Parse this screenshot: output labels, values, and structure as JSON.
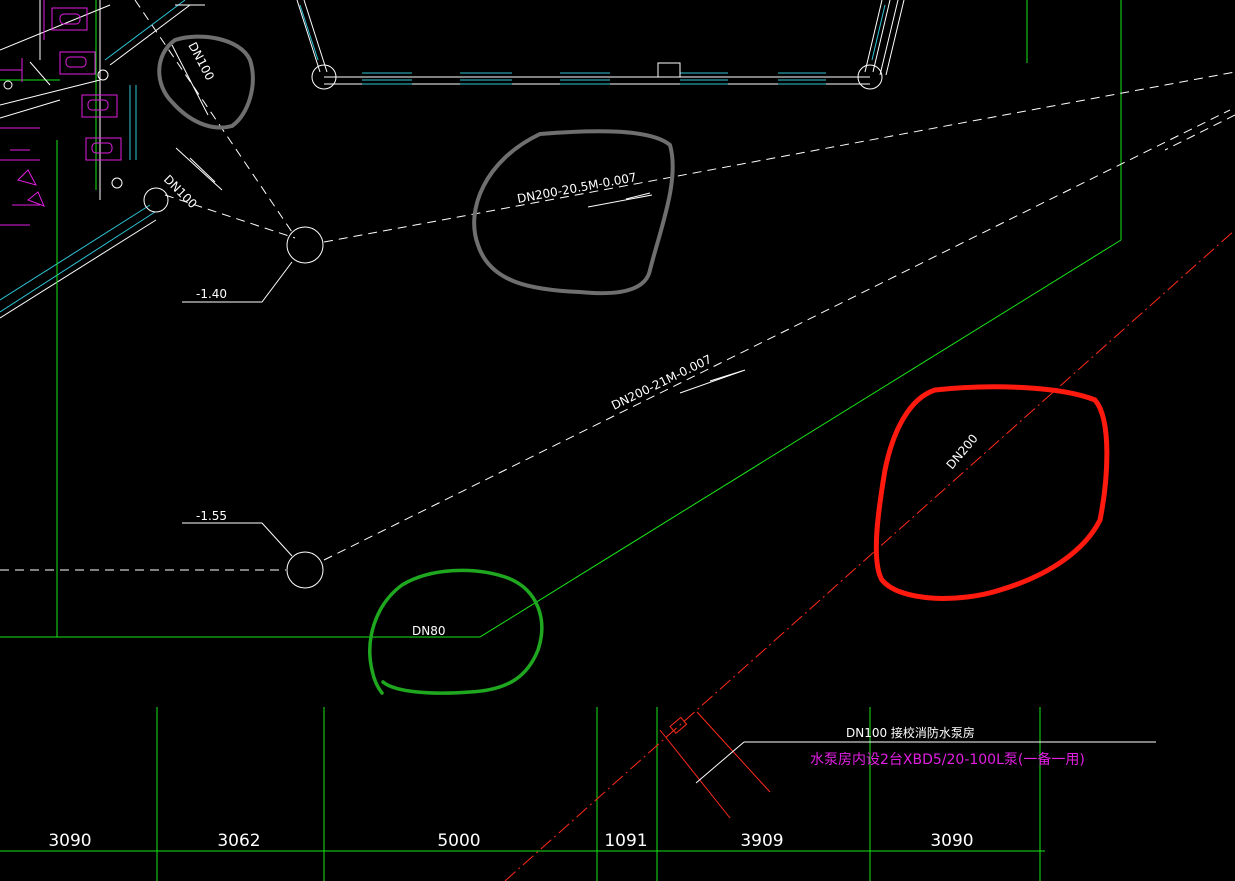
{
  "labels": {
    "dn100_top": "DN100",
    "dn100_mid": "DN100",
    "pipe_upper": "DN200-20.5M-0.007",
    "pipe_lower": "DN200-21M-0.007",
    "elev_upper": "-1.40",
    "elev_lower": "-1.55",
    "dn80": "DN80",
    "dn200": "DN200",
    "pump_note_1": "DN100 接校消防水泵房",
    "pump_note_2": "水泵房内设2台XBD5/20-100L泵(一备一用)"
  },
  "dimensions": [
    "3090",
    "3062",
    "5000",
    "1091",
    "3909",
    "3090"
  ],
  "colors": {
    "background": "#000000",
    "pipe": "#ffffff",
    "grid": "#19e619",
    "wall": "#2ec4d6",
    "fixture": "#e21ee2",
    "fire_line": "#ff2a1a",
    "markup_gray": "#6f6f6f",
    "markup_green": "#1fa81f",
    "markup_red": "#ff1a0f"
  }
}
